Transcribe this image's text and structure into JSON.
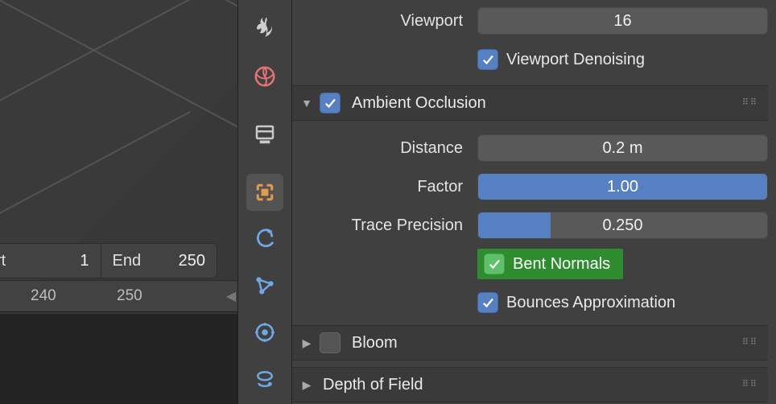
{
  "timeline": {
    "start_label": "rt",
    "start_value": "1",
    "end_label": "End",
    "end_value": "250",
    "ticks": {
      "a": "240",
      "b": "250"
    }
  },
  "viewport_row": {
    "label": "Viewport",
    "value": "16"
  },
  "viewport_denoising": {
    "label": "Viewport Denoising"
  },
  "sections": {
    "ao": {
      "title": "Ambient Occlusion",
      "distance_label": "Distance",
      "distance_value": "0.2 m",
      "factor_label": "Factor",
      "factor_value": "1.00",
      "trace_label": "Trace Precision",
      "trace_value": "0.250",
      "bent_label": "Bent Normals",
      "bounces_label": "Bounces Approximation"
    },
    "bloom": {
      "title": "Bloom"
    },
    "dof": {
      "title": "Depth of Field"
    }
  }
}
